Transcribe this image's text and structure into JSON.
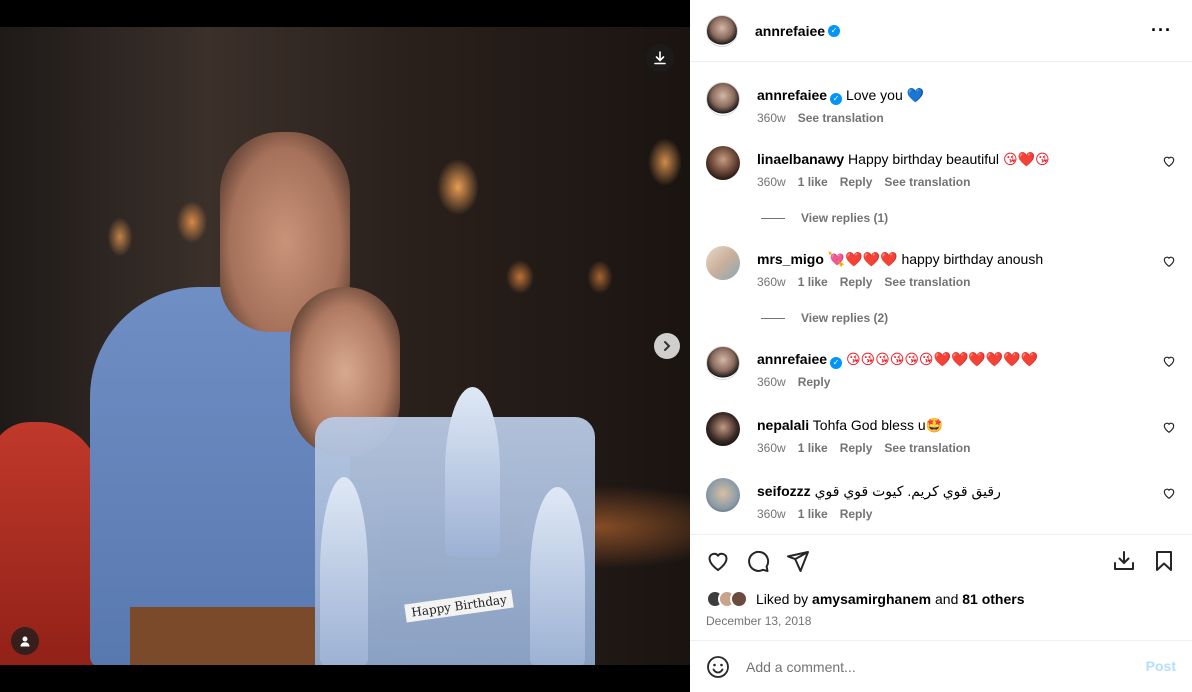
{
  "post": {
    "author": "annrefaiee",
    "verified": true
  },
  "caption": {
    "username": "annrefaiee",
    "text": "Love you",
    "emoji": "💙",
    "time": "360w",
    "see_translation": "See translation"
  },
  "comments": [
    {
      "username": "linaelbanawy",
      "text": "Happy birthday beautiful",
      "emoji": "😘❤️😘",
      "time": "360w",
      "likes": "1 like",
      "reply": "Reply",
      "see_translation": "See translation",
      "view_replies": "View replies (1)"
    },
    {
      "username": "mrs_migo",
      "emoji_prefix": "💘❤️❤️❤️",
      "text": "happy birthday anoush",
      "time": "360w",
      "likes": "1 like",
      "reply": "Reply",
      "see_translation": "See translation",
      "view_replies": "View replies (2)"
    },
    {
      "username": "annrefaiee",
      "verified": true,
      "emoji": "😘😘😘😘😘😘❤️❤️❤️❤️❤️❤️",
      "time": "360w",
      "reply": "Reply"
    },
    {
      "username": "nepalali",
      "text": "Tohfa God bless u",
      "emoji": "🤩",
      "time": "360w",
      "likes": "1 like",
      "reply": "Reply",
      "see_translation": "See translation"
    },
    {
      "username": "seifozzz",
      "text": "رقيق قوي كريم. كيوت قوي قوي",
      "time": "360w",
      "likes": "1 like",
      "reply": "Reply"
    }
  ],
  "likes": {
    "prefix": "Liked by",
    "user": "amysamirghanem",
    "middle": "and",
    "others": "81 others"
  },
  "date": "December 13, 2018",
  "add_comment": {
    "placeholder": "Add a comment...",
    "post_label": "Post"
  },
  "photo": {
    "cake_text": "Happy Birthday"
  },
  "colors": {
    "verified_blue": "#0095f6",
    "link_muted": "#737373",
    "post_disabled": "#b2dffc"
  }
}
